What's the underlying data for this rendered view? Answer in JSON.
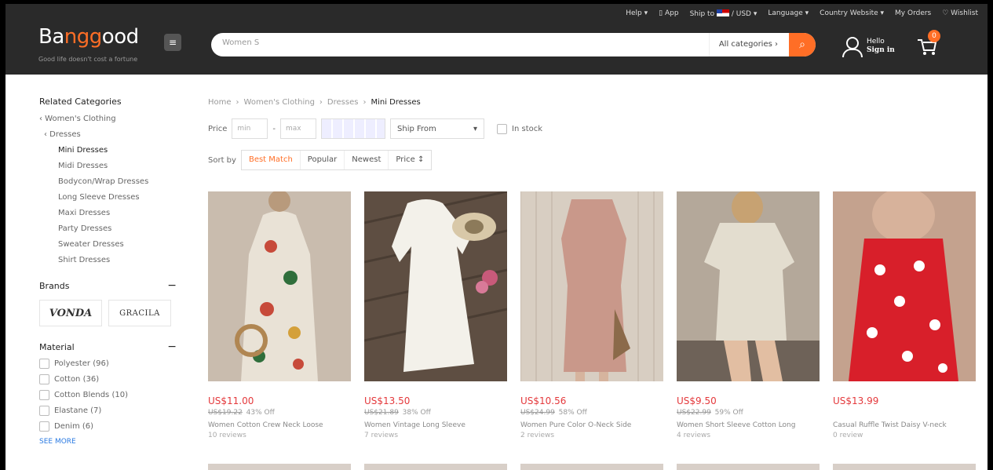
{
  "topbar": {
    "help": "Help ▾",
    "app": "App",
    "ship_to": "Ship to",
    "currency": "/ USD ▾",
    "language": "Language ▾",
    "country": "Country Website ▾",
    "orders": "My Orders",
    "wishlist": "♡ Wishlist"
  },
  "header": {
    "logo_pre": "Ba",
    "logo_accent": "ngg",
    "logo_post": "ood",
    "tagline": "Good life doesn't cost a fortune",
    "search_value": "Women S",
    "category": "All categories ›",
    "hello": "Hello",
    "sign_in": "Sign in",
    "cart_count": "0"
  },
  "sidebar": {
    "related_title": "Related Categories",
    "parent": "‹ Women's Clothing",
    "sub_parent": "‹ Dresses",
    "categories": [
      "Mini Dresses",
      "Midi Dresses",
      "Bodycon/Wrap Dresses",
      "Long Sleeve Dresses",
      "Maxi Dresses",
      "Party Dresses",
      "Sweater Dresses",
      "Shirt Dresses"
    ],
    "brands_title": "Brands",
    "brands": [
      "VONDA",
      "GRACILA"
    ],
    "material_title": "Material",
    "materials": [
      "Polyester (96)",
      "Cotton (36)",
      "Cotton Blends (10)",
      "Elastane (7)",
      "Denim (6)"
    ],
    "see_more": "SEE MORE"
  },
  "breadcrumb": {
    "home": "Home",
    "sep": "›",
    "l1": "Women's Clothing",
    "l2": "Dresses",
    "current": "Mini Dresses"
  },
  "filters": {
    "price_label": "Price",
    "min": "min",
    "dash": "-",
    "max": "max",
    "ship_from": "Ship From",
    "in_stock": "In stock"
  },
  "sort": {
    "label": "Sort by",
    "options": [
      "Best Match",
      "Popular",
      "Newest",
      "Price ↕"
    ]
  },
  "products": [
    {
      "price": "US$11.00",
      "old": "US$19.22",
      "off": "43% Off",
      "title": "Women Cotton Crew Neck Loose",
      "reviews": "10 reviews"
    },
    {
      "price": "US$13.50",
      "old": "US$21.89",
      "off": "38% Off",
      "title": "Women Vintage Long Sleeve",
      "reviews": "7 reviews"
    },
    {
      "price": "US$10.56",
      "old": "US$24.99",
      "off": "58% Off",
      "title": "Women Pure Color O-Neck Side",
      "reviews": "2 reviews"
    },
    {
      "price": "US$9.50",
      "old": "US$22.99",
      "off": "59% Off",
      "title": "Women Short Sleeve Cotton Long",
      "reviews": "4 reviews"
    },
    {
      "price": "US$13.99",
      "old": "",
      "off": "",
      "title": "Casual Ruffle Twist Daisy V-neck",
      "reviews": "0 review"
    }
  ],
  "colors": {
    "accent": "#ff6e26",
    "price": "#e4393c",
    "header_bg": "#2a2a2a"
  }
}
